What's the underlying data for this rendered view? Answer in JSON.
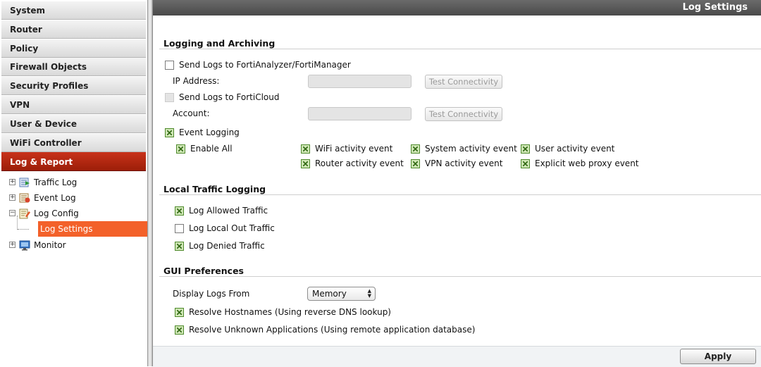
{
  "sidebar": {
    "menu": [
      "System",
      "Router",
      "Policy",
      "Firewall Objects",
      "Security Profiles",
      "VPN",
      "User & Device",
      "WiFi Controller",
      "Log & Report"
    ],
    "active_menu": "Log & Report",
    "tree": {
      "traffic_log": "Traffic Log",
      "event_log": "Event Log",
      "log_config": "Log Config",
      "log_settings": "Log Settings",
      "monitor": "Monitor"
    }
  },
  "header": {
    "title": "Log Settings"
  },
  "logging": {
    "section_title": "Logging and Archiving",
    "send_analyzer": "Send Logs to FortiAnalyzer/FortiManager",
    "ip_address_label": "IP Address:",
    "test_connectivity": "Test Connectivity",
    "send_forticloud": "Send Logs to FortiCloud",
    "account_label": "Account:",
    "event_logging": "Event Logging",
    "enable_all": "Enable All",
    "wifi_event": "WiFi activity event",
    "system_event": "System activity event",
    "user_event": "User activity event",
    "router_event": "Router activity event",
    "vpn_event": "VPN activity event",
    "proxy_event": "Explicit web proxy event"
  },
  "local_traffic": {
    "section_title": "Local Traffic Logging",
    "allowed": "Log Allowed Traffic",
    "local_out": "Log Local Out Traffic",
    "denied": "Log Denied Traffic"
  },
  "gui": {
    "section_title": "GUI Preferences",
    "display_label": "Display Logs From",
    "display_value": "Memory",
    "resolve_hostnames": "Resolve Hostnames (Using reverse DNS lookup)",
    "resolve_apps": "Resolve Unknown Applications (Using remote application database)"
  },
  "footer": {
    "apply": "Apply"
  },
  "colors": {
    "active_menu": "#b0280f",
    "selected_tree": "#f3612a",
    "titlebar": "#555555",
    "check_green": "#4f8a2c"
  }
}
